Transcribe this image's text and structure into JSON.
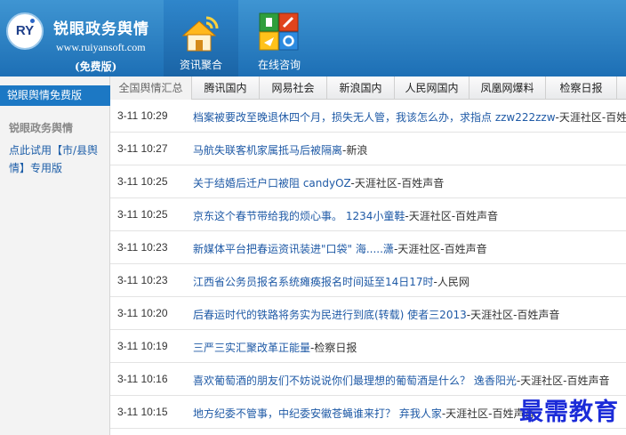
{
  "brand": {
    "logo_text": "RY",
    "title": "锐眼政务舆情",
    "url": "www.ruiyansoft.com",
    "tag": "(免费版)"
  },
  "nav": [
    {
      "label": "资讯聚合",
      "icon": "house-wifi-icon",
      "active": true
    },
    {
      "label": "在线咨询",
      "icon": "app-grid-icon",
      "active": false
    }
  ],
  "tabs": [
    "全国舆情汇总",
    "腾讯国内",
    "网易社会",
    "新浪国内",
    "人民网国内",
    "凤凰网爆料",
    "检察日报"
  ],
  "sidebar": {
    "active_item": "锐眼舆情免费版",
    "section_title": "锐眼政务舆情",
    "trial_link": "点此试用【市/县舆情】专用版"
  },
  "news": [
    {
      "time": "3-11 10:29",
      "title": "档案被要改至晚退休四个月，损失无人管，我该怎么办，求指点 zzw222zzw",
      "source": "-天涯社区-百姓声音"
    },
    {
      "time": "3-11 10:27",
      "title": "马航失联客机家属抵马后被隔离",
      "source": "-新浪"
    },
    {
      "time": "3-11 10:25",
      "title": "关于结婚后迁户口被阻 candyOZ",
      "source": "-天涯社区-百姓声音"
    },
    {
      "time": "3-11 10:25",
      "title": "京东这个春节带给我的烦心事。 1234小童鞋",
      "source": "-天涯社区-百姓声音"
    },
    {
      "time": "3-11 10:23",
      "title": "新媒体平台把春运资讯装进\"口袋\" 海.....潇",
      "source": "-天涯社区-百姓声音"
    },
    {
      "time": "3-11 10:23",
      "title": "江西省公务员报名系统瘫痪报名时间延至14日17时",
      "source": "-人民网"
    },
    {
      "time": "3-11 10:20",
      "title": "后春运时代的铁路将务实为民进行到底(转载) 使者三2013",
      "source": "-天涯社区-百姓声音"
    },
    {
      "time": "3-11 10:19",
      "title": "三严三实汇聚改革正能量",
      "source": "-检察日报"
    },
    {
      "time": "3-11 10:16",
      "title": "喜欢葡萄酒的朋友们不妨说说你们最理想的葡萄酒是什么？ 逸香阳光",
      "source": "-天涯社区-百姓声音"
    },
    {
      "time": "3-11 10:15",
      "title": "地方纪委不管事，中纪委安徽苍蝇谁来打？ 弃我人家",
      "source": "-天涯社区-百姓声音"
    }
  ],
  "watermark": "最需教育",
  "colors": {
    "header": "#2a82c8",
    "accent": "#1c78c4",
    "link": "#1f5aa6"
  }
}
